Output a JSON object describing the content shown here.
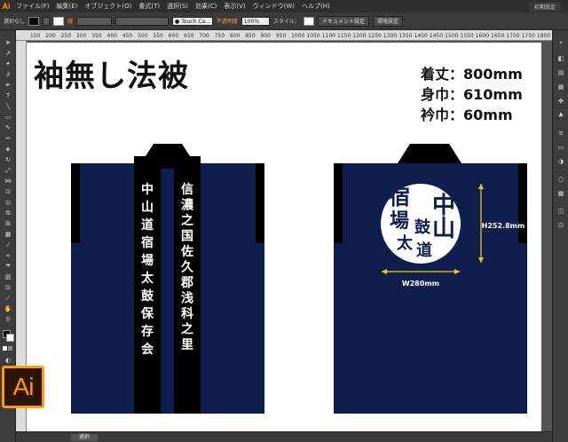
{
  "menubar": {
    "app_logo": "Ai",
    "items": [
      "ファイル(F)",
      "編集(E)",
      "オブジェクト(O)",
      "書式(T)",
      "選択(S)",
      "効果(C)",
      "表示(V)",
      "ウィンドウ(W)",
      "ヘルプ(H)"
    ],
    "workspace": "初期設定"
  },
  "controlbar": {
    "selection": "選択なし",
    "stroke_label": "線",
    "brush": "Touch Ca...",
    "opacity_label": "不透明度",
    "opacity_value": "100%",
    "style_label": "スタイル：",
    "doc_settings": "ドキュメント設定",
    "env_settings": "環境設定"
  },
  "ruler": {
    "ticks": [
      "150",
      "200",
      "250",
      "300",
      "350",
      "400",
      "450",
      "500",
      "550",
      "600",
      "650",
      "700",
      "750",
      "800",
      "850",
      "900",
      "950",
      "1000",
      "1050",
      "1100",
      "1150",
      "1200",
      "1250",
      "1300",
      "1350",
      "1400",
      "1450",
      "1500",
      "1550",
      "1600",
      "1650",
      "1700",
      "1750",
      "1800"
    ]
  },
  "artboard": {
    "title": "袖無し法被",
    "specs": [
      "着丈：800mm",
      "身巾：610mm",
      "衿巾：60mm"
    ],
    "front_left_text": "中山道宿場太鼓保存会",
    "front_right_text": "信濃之国佐久郡浅科之里",
    "back_logo_chars": [
      "中",
      "山",
      "道",
      "宿",
      "場",
      "太",
      "鼓"
    ],
    "dim_width": "W280mm",
    "dim_height": "H252.8mm"
  },
  "statusbar": {
    "tool": "選択"
  },
  "colors": {
    "navy": "#0e1f4e",
    "black": "#000000",
    "dimension": "#f5d000",
    "accent": "#ff9a00"
  },
  "big_logo": "Ai"
}
